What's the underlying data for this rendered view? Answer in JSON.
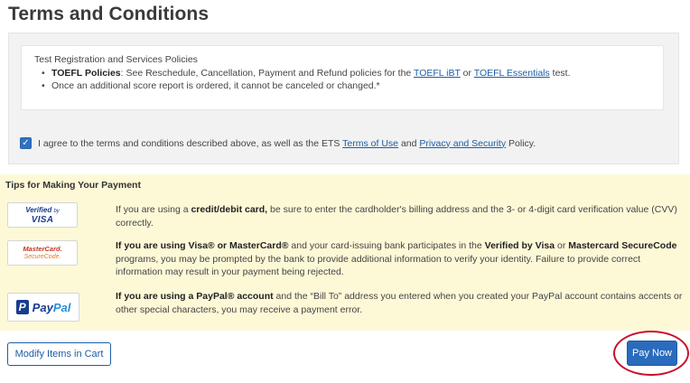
{
  "page_title": "Terms and Conditions",
  "terms": {
    "heading": "Test Registration and Services Policies",
    "bullet1_label": "TOEFL Policies",
    "bullet1_text_a": ": See Reschedule, Cancellation, Payment and Refund policies for the ",
    "bullet1_link1": "TOEFL iBT",
    "bullet1_or": " or ",
    "bullet1_link2": "TOEFL Essentials",
    "bullet1_text_b": " test.",
    "bullet2": "Once an additional score report is ordered, it cannot be canceled or changed.*",
    "agree_checked": true,
    "agree_text_a": "I agree to the terms and conditions described above, as well as the ETS ",
    "agree_link1": "Terms of Use",
    "agree_and": " and ",
    "agree_link2": "Privacy and Security",
    "agree_text_b": " Policy."
  },
  "tips": {
    "title": "Tips for Making Your Payment",
    "visa_logo_line1": "Verified",
    "visa_logo_by": "by",
    "visa_logo_line2": "VISA",
    "mc_logo_line1": "MasterCard.",
    "mc_logo_line2": "SecureCode.",
    "paypal_logo_mark": "P",
    "paypal_logo_a": "Pay",
    "paypal_logo_b": "Pal",
    "tip1_a": "If you are using a ",
    "tip1_bold": "credit/debit card,",
    "tip1_b": " be sure to enter the cardholder's billing address and the 3- or 4-digit card verification value (CVV) correctly.",
    "tip2_bold1": "If you are using Visa® or MasterCard®",
    "tip2_a": " and your card-issuing bank participates in the ",
    "tip2_bold2": "Verified by Visa",
    "tip2_or": " or ",
    "tip2_bold3": "Mastercard SecureCode",
    "tip2_b": " programs, you may be prompted by the bank to provide additional information to verify your identity. Failure to provide correct information may result in your payment being rejected.",
    "tip3_bold": "If you are using a PayPal® account",
    "tip3_a": " and the “Bill To” address you entered when you created your PayPal account contains accents or other special characters, you may receive a payment error."
  },
  "actions": {
    "modify_label": "Modify Items in Cart",
    "pay_label": "Pay Now"
  },
  "colors": {
    "link": "#1b5ea6",
    "tips_background": "#fdf9d7",
    "pay_button": "#2a6bbd",
    "highlight_circle": "#c8102e"
  }
}
